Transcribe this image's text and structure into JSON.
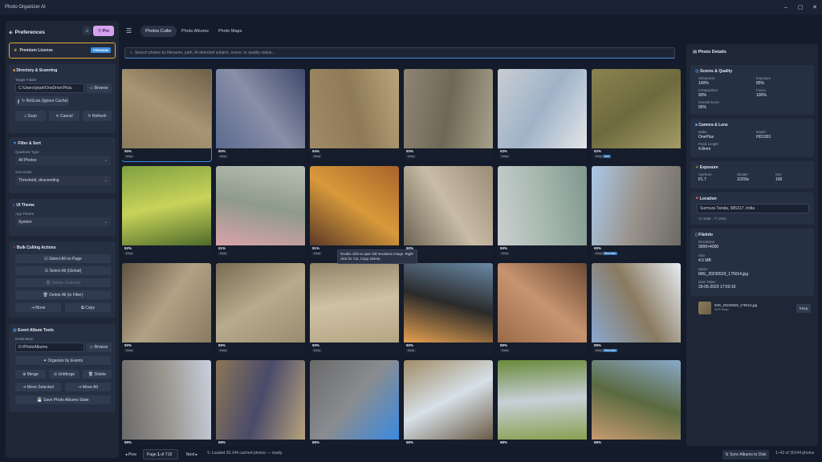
{
  "window": {
    "title": "Photo Organizer AI",
    "controls": [
      "–",
      "▢",
      "✕"
    ]
  },
  "left": {
    "title": "Preferences",
    "pin_label": "Pin",
    "premium": {
      "label": "Premium License",
      "badge": "PREMIUM"
    },
    "dir": {
      "title": "Directory & Scanning",
      "target_label": "Target Folder",
      "target_value": "C:\\Users\\ykart\\OneDrive\\Pictu",
      "browse": "Browse",
      "rescan": "ReScan (Ignore Cache)",
      "scan": "Scan",
      "cancel": "Cancel",
      "refresh": "Refresh"
    },
    "filter": {
      "title": "Filter & Sort",
      "quadrant_label": "Quadrant Type",
      "quadrant_value": "All Photos",
      "sort_label": "Sort Order",
      "sort_value": "Threshold, descending"
    },
    "theme": {
      "title": "UI Theme",
      "label": "App Theme",
      "value": "System"
    },
    "bulk": {
      "title": "Bulk Culling Actions",
      "select_page": "Select All on Page",
      "select_global": "Select All (Global)",
      "delete_selected": "Delete Selected",
      "delete_all": "Delete All (in Filter)",
      "move": "Move",
      "copy": "Copy"
    },
    "event": {
      "title": "Event Album Tools",
      "dest_label": "Destination",
      "dest_value": "D:\\PhotoAlbums",
      "browse": "Browse",
      "organize": "Organize by Events",
      "merge": "Merge",
      "unmerge": "UnMerge",
      "delete": "Delete",
      "move_selected": "Move Selected",
      "move_all": "Move All",
      "save_state": "Save Photo Albums State"
    }
  },
  "main": {
    "tabs": [
      "Photos Culler",
      "Photo Albums",
      "Photo Maps"
    ],
    "search_placeholder": "Search photos by filename, path, AI detected subject, scene, or quality status...",
    "tooltip": "Double click to open full resolution image. Right-click for Cut, Copy, Delete."
  },
  "tiles": [
    {
      "pct": "90%",
      "tag": "Keep",
      "colors": [
        "#8b7a5c",
        "#a89573",
        "#6d5f48"
      ]
    },
    {
      "pct": "90%",
      "tag": "Keep",
      "colors": [
        "#5a6a8f",
        "#8a8fa8",
        "#3f4a6a"
      ]
    },
    {
      "pct": "94%",
      "tag": "Keep",
      "colors": [
        "#a08a66",
        "#8f7a57",
        "#b9a47d"
      ]
    },
    {
      "pct": "93%",
      "tag": "Keep",
      "colors": [
        "#8e8672",
        "#6f6855",
        "#a7a08a"
      ]
    },
    {
      "pct": "93%",
      "tag": "Keep",
      "colors": [
        "#c9cdd2",
        "#9fb3c8",
        "#e3e5e8"
      ]
    },
    {
      "pct": "92%",
      "tag": "Keep",
      "tag2": "Soil",
      "colors": [
        "#8a8350",
        "#6e6a3e",
        "#a49c66"
      ]
    },
    {
      "pct": "92%",
      "tag": "Keep",
      "colors": [
        "#7fa040",
        "#c8d35a",
        "#4e6b2a"
      ]
    },
    {
      "pct": "91%",
      "tag": "Keep",
      "colors": [
        "#b8c0b4",
        "#8e9a8c",
        "#d9a3a8"
      ]
    },
    {
      "pct": "91%",
      "tag": "Keep",
      "colors": [
        "#a8622a",
        "#d89a3a",
        "#5a3a28"
      ]
    },
    {
      "pct": "90%",
      "tag": "Keep",
      "colors": [
        "#9a8c76",
        "#c8bca6",
        "#6d6454"
      ]
    },
    {
      "pct": "90%",
      "tag": "Keep",
      "colors": [
        "#7f9890",
        "#a7b8ae",
        "#c9cfd0"
      ]
    },
    {
      "pct": "90%",
      "tag": "Keep",
      "tag2": "Mountain",
      "colors": [
        "#6d6a66",
        "#99948c",
        "#aac8e8"
      ]
    },
    {
      "pct": "90%",
      "tag": "Keep",
      "colors": [
        "#8a7a62",
        "#b2a184",
        "#5e5242"
      ]
    },
    {
      "pct": "90%",
      "tag": "Keep",
      "colors": [
        "#9a8c70",
        "#b8aa8c",
        "#7a6c52"
      ]
    },
    {
      "pct": "90%",
      "tag": "Keep",
      "colors": [
        "#b5a584",
        "#cfc2a4",
        "#8f8266"
      ]
    },
    {
      "pct": "90%",
      "tag": "Keep",
      "colors": [
        "#e6a050",
        "#2a2a2a",
        "#6a8aa8"
      ]
    },
    {
      "pct": "89%",
      "tag": "Keep",
      "colors": [
        "#9a6a48",
        "#c89470",
        "#6a4a34"
      ]
    },
    {
      "pct": "89%",
      "tag": "Keep",
      "tag2": "Mountain",
      "colors": [
        "#8aa8d0",
        "#8a7a60",
        "#e6ecf2"
      ]
    },
    {
      "pct": "89%",
      "tag": "Keep",
      "colors": [
        "#6a6a6a",
        "#9a9690",
        "#c8d0dc"
      ]
    },
    {
      "pct": "88%",
      "tag": "Keep",
      "colors": [
        "#8a7656",
        "#4a4a6a",
        "#b8a47c"
      ]
    },
    {
      "pct": "88%",
      "tag": "Keep",
      "colors": [
        "#6a6a6a",
        "#8a8c90",
        "#3a8ae0"
      ]
    },
    {
      "pct": "88%",
      "tag": "Keep",
      "colors": [
        "#a08c68",
        "#d6e0e8",
        "#6a5a44"
      ]
    },
    {
      "pct": "88%",
      "tag": "Keep",
      "colors": [
        "#6a8a3a",
        "#c8d0d8",
        "#8aa050"
      ]
    },
    {
      "pct": "88%",
      "tag": "Keep",
      "colors": [
        "#8aa8c8",
        "#5a6a40",
        "#c89a70"
      ]
    }
  ],
  "bottom": {
    "prev": "Prev",
    "page_label": "Page",
    "page_value": "1",
    "page_total": "of 718",
    "next": "Next",
    "status": "Loaded 30,144 cached photos — ready.",
    "sync": "Sync Albums to Disk",
    "count": "1–42",
    "count_total": "of  30144 photos"
  },
  "right": {
    "title": "Photo Details",
    "scores": {
      "title": "Scores & Quality",
      "sharpness_k": "Sharpness",
      "sharpness_v": "100%",
      "exposure_k": "Exposure",
      "exposure_v": "85%",
      "composition_k": "Composition",
      "composition_v": "90%",
      "focus_k": "Focus",
      "focus_v": "100%",
      "overall_k": "Overall Score",
      "overall_v": "95%"
    },
    "camera": {
      "title": "Camera & Lens",
      "make_k": "Make",
      "make_v": "OnePlus",
      "model_k": "Model",
      "model_v": "HD1901",
      "focal_k": "Focal Length",
      "focal_v": "4.8mm"
    },
    "exposure": {
      "title": "Exposure",
      "aperture_k": "Aperture",
      "aperture_v": "f/1.7",
      "shutter_k": "Shutter",
      "shutter_v": "1/203s",
      "iso_k": "ISO",
      "iso_v": "100"
    },
    "location": {
      "title": "Location",
      "place": "Surmura Tarsila, 585317, India",
      "coords": "17.3456 , 77.3022"
    },
    "fileinfo": {
      "title": "FileInfo",
      "res_k": "Resolution",
      "res_v": "3000×4000",
      "size_k": "Size",
      "size_v": "4.5 MB",
      "name_k": "Name",
      "name_v": "IMG_20230529_175014.jpg",
      "date_k": "Date Taken",
      "date_v": "29-05-2023 17:50:15"
    },
    "thumb": {
      "name": "IMG_20230529_175014.jpg",
      "meta": "90%",
      "meta2": "Keep",
      "keep": "Keep"
    }
  }
}
